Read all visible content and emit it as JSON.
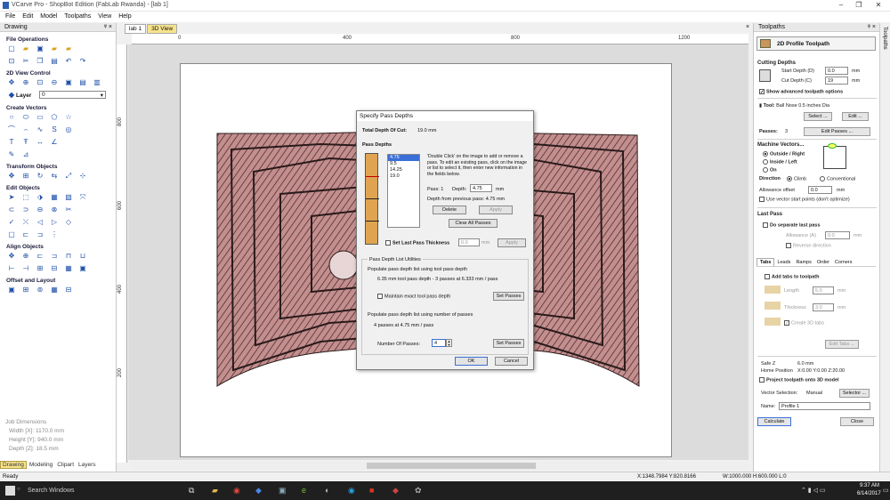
{
  "app": {
    "title": "VCarve Pro - ShopBot Edition (FabLab Rwanda) - [lab 1]"
  },
  "menu": [
    "File",
    "Edit",
    "Model",
    "Toolpaths",
    "View",
    "Help"
  ],
  "left": {
    "header": "Drawing",
    "pin": "ᵠ ×",
    "sections": {
      "file_ops": "File Operations",
      "view_control": "2D View Control",
      "create_vectors": "Create Vectors",
      "transform": "Transform Objects",
      "edit": "Edit Objects",
      "align": "Align Objects",
      "offset": "Offset and Layout"
    },
    "layer_label": "Layer",
    "layer_value": "0"
  },
  "job": {
    "header": "Job Dimensions",
    "width": "Width  [X]: 1170.0 mm",
    "height": "Height [Y]: 940.0 mm",
    "depth": "Depth  [Z]: 18.5 mm"
  },
  "bottom_tabs": [
    "Drawing",
    "Modeling",
    "Clipart",
    "Layers"
  ],
  "doc_tabs": [
    "lab 1",
    "3D View"
  ],
  "ruler": {
    "top": [
      "0",
      "400",
      "800",
      "1200"
    ],
    "left": [
      "800",
      "600",
      "400",
      "200"
    ]
  },
  "dialog": {
    "title": "Specify Pass Depths",
    "total_depth_label": "Total Depth Of Cut:",
    "total_depth_value": "19.0 mm",
    "pass_depths_header": "Pass Depths",
    "passes": [
      "4.75",
      "9.5",
      "14.25",
      "19.0"
    ],
    "hint": "'Double Click' on the image to add or remove a pass. To edit an existing pass, click on the image or list to select it, then enter new information in the fields below.",
    "pass_label": "Pass: 1",
    "depth_label": "Depth:",
    "depth_value": "4.75",
    "mm": "mm",
    "depth_prev": "Depth from previous pass:  4.75 mm",
    "delete": "Delete",
    "apply": "Apply",
    "clear_all": "Clear All Passes",
    "set_last_label": "Set Last Pass Thickness",
    "set_last_value": "0.0",
    "utilities_header": "Pass Depth List Utilities",
    "util_tool": "Populate pass depth list using tool pass depth",
    "util_tool_result": "6.35 mm tool pass depth - 3 passes at 6.333 mm / pass",
    "maintain_exact": "Maintain exact tool pass depth",
    "set_passes": "Set Passes",
    "util_num": "Populate pass depth list using number of passes",
    "util_num_result": "4 passes at 4.75 mm / pass",
    "num_passes_label": "Number Of Passes:",
    "num_passes_value": "4",
    "ok": "OK",
    "cancel": "Cancel"
  },
  "right": {
    "header": "Toolpaths",
    "pin": "ᵠ ×",
    "side_tab": "Toolpaths",
    "tp_title": "2D Profile Toolpath",
    "cutting_depths": "Cutting Depths",
    "start_depth_label": "Start Depth (D)",
    "start_depth": "0.0",
    "cut_depth_label": "Cut Depth (C)",
    "cut_depth": "19",
    "show_adv": "Show advanced toolpath options",
    "tool_label": "Tool:",
    "tool_value": "Ball Nose 0.5 inches Dia",
    "select": "Select ...",
    "edit": "Edit ...",
    "passes_label": "Passes:",
    "passes_value": "3",
    "edit_passes": "Edit Passes ...",
    "machine_vectors": "Machine Vectors...",
    "outside": "Outside / Right",
    "inside": "Inside / Left",
    "on": "On",
    "direction": "Direction",
    "climb": "Climb",
    "conventional": "Conventional",
    "allowance_label": "Allowance offset",
    "allowance": "0.0",
    "use_vector": "Use vector start points (don't optimize)",
    "last_pass": "Last Pass",
    "no_sep": "Do separate last pass",
    "allowance_a": "Allowance (A)",
    "allowance_a_val": "0.0",
    "reverse": "Reverse direction",
    "tabs": [
      "Tabs",
      "Leads",
      "Ramps",
      "Order",
      "Corners"
    ],
    "add_tabs": "Add tabs to toolpath",
    "length": "Length",
    "length_val": "5.0",
    "thickness": "Thickness",
    "thickness_val": "3.0",
    "create3d": "Create 3D tabs",
    "edit_tabs": "Edit Tabs ...",
    "safez_label": "Safe Z",
    "safez": "6.0 mm",
    "home_label": "Home Position",
    "home": "X:0.00 Y:0.00 Z:20.00",
    "project": "Project toolpath onto 3D model",
    "vec_sel_label": "Vector Selection:",
    "vec_sel": "Manual",
    "selector": "Selector ...",
    "name_label": "Name:",
    "name": "Profile 1",
    "calculate": "Calculate",
    "close": "Close"
  },
  "status": {
    "ready": "Ready",
    "coords": "X:1348.7984 Y:820.8166",
    "size": "W:1000.000  H:600.000  L:0"
  },
  "taskbar": {
    "search": "Search Windows",
    "time": "9:37 AM",
    "date": "6/14/2017"
  }
}
